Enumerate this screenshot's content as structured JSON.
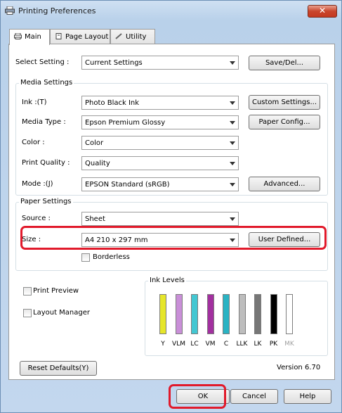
{
  "window": {
    "title": "Printing Preferences",
    "close_glyph": "✕"
  },
  "tabs": [
    {
      "label": "Main",
      "icon": "printer-icon"
    },
    {
      "label": "Page Layout",
      "icon": "page-icon"
    },
    {
      "label": "Utility",
      "icon": "pencil-icon"
    }
  ],
  "select_setting": {
    "label": "Select Setting :",
    "value": "Current Settings",
    "button": "Save/Del..."
  },
  "media_settings": {
    "title": "Media Settings",
    "ink": {
      "label": "Ink :(T)",
      "value": "Photo Black Ink",
      "button": "Custom Settings..."
    },
    "media_type": {
      "label": "Media Type :",
      "value": "Epson Premium Glossy",
      "button": "Paper Config..."
    },
    "color": {
      "label": "Color :",
      "value": "Color"
    },
    "print_quality": {
      "label": "Print Quality :",
      "value": "Quality"
    },
    "mode": {
      "label": "Mode :(J)",
      "value": "EPSON Standard (sRGB)",
      "button": "Advanced..."
    }
  },
  "paper_settings": {
    "title": "Paper Settings",
    "source": {
      "label": "Source :",
      "value": "Sheet"
    },
    "size": {
      "label": "Size :",
      "value": "A4 210 x 297 mm",
      "button": "User Defined..."
    },
    "borderless": {
      "label": "Borderless",
      "checked": false
    }
  },
  "print_preview": {
    "label": "Print Preview",
    "checked": false
  },
  "layout_manager": {
    "label": "Layout Manager",
    "checked": false
  },
  "ink_levels": {
    "title": "Ink Levels",
    "inks": [
      {
        "name": "Y",
        "color": "#e6e62a",
        "level": 1.0
      },
      {
        "name": "VLM",
        "color": "#c98fd8",
        "level": 1.0
      },
      {
        "name": "LC",
        "color": "#43c7d2",
        "level": 1.0
      },
      {
        "name": "VM",
        "color": "#a2309f",
        "level": 1.0
      },
      {
        "name": "C",
        "color": "#2ab3c3",
        "level": 1.0
      },
      {
        "name": "LLK",
        "color": "#bdbdbd",
        "level": 1.0
      },
      {
        "name": "LK",
        "color": "#777777",
        "level": 1.0
      },
      {
        "name": "PK",
        "color": "#000000",
        "level": 1.0
      },
      {
        "name": "MK",
        "color": "#ffffff",
        "level": 0.0
      }
    ]
  },
  "reset_defaults": "Reset Defaults(Y)",
  "version": "Version 6.70",
  "footer": {
    "ok": "OK",
    "cancel": "Cancel",
    "help": "Help"
  },
  "colors": {
    "highlight": "#e11a2b"
  }
}
